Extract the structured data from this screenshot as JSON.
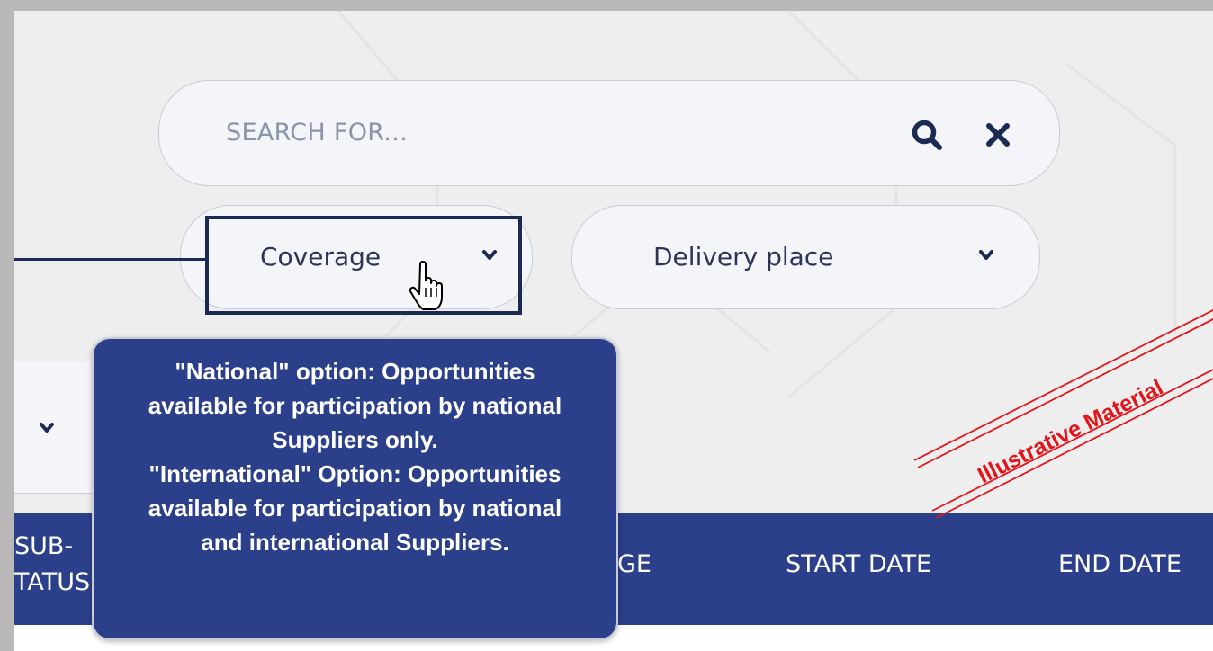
{
  "search": {
    "placeholder": "SEARCH FOR...",
    "search_icon": "search-icon",
    "clear_icon": "close-icon"
  },
  "filters": {
    "coverage": {
      "label": "Coverage",
      "icon": "chevron-down-icon"
    },
    "delivery_place": {
      "label": "Delivery place",
      "icon": "chevron-down-icon"
    },
    "side_select": {
      "icon": "chevron-down-icon"
    }
  },
  "tooltip": {
    "lines": [
      "\"National\" option: Opportunities",
      "available for participation by national",
      "Suppliers only.",
      "\"International\" Option: Opportunities",
      "available for participation by national",
      "and international Suppliers."
    ]
  },
  "table": {
    "headers": {
      "sub_status_line1": "SUB-",
      "sub_status_line2": "TATUS",
      "stage_partial": "GE",
      "start_date": "START DATE",
      "end_date": "END DATE"
    }
  },
  "watermark": {
    "text": "Illustrative Material"
  },
  "colors": {
    "accent_dark": "#1b2a52",
    "header_blue": "#2b3f8a",
    "watermark_red": "#e3151a",
    "background": "#eeeeef"
  },
  "cursor": {
    "icon": "hand-pointer-icon"
  }
}
